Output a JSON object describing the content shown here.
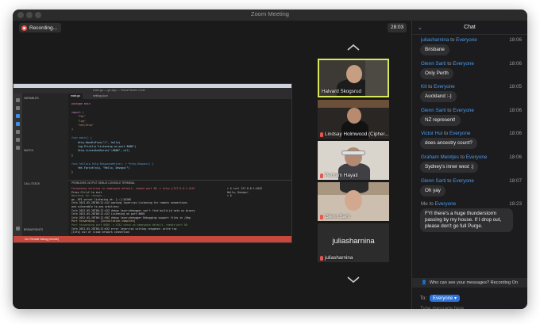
{
  "window": {
    "title": "Zoom Meeting"
  },
  "recording": {
    "label": "Recording..."
  },
  "timer": "28:03",
  "share": {
    "vscode_title": "main.go — go-app — Visual Studio Code",
    "sidebar_explorer": "VARIABLES",
    "sidebar_watch": "WATCH",
    "sidebar_callstack": "CALL STACK",
    "sidebar_breakpoints": "BREAKPOINTS",
    "tab_main": "main.go",
    "tab_settings": "settings.json",
    "panel_tabs": "PROBLEMS   OUTPUT   DEBUG CONSOLE   TERMINAL",
    "status_text": "Go: Remote Debug (remote)",
    "code": [
      "package main",
      "",
      "import (",
      "    \"fmt\"",
      "    \"log\"",
      "    \"net/http\"",
      ")",
      "",
      "func main() {",
      "    http.HandleFunc(\"/\", hello)",
      "    log.Println(\"Listening on port 8080\")",
      "    http.ListenAndServe(\":8080\", nil)",
      "}",
      "",
      "func hello(w http.ResponseWriter, r *http.Request) {",
      "    fmt.Fprintln(w, \"Hello, Devops!\")",
      "}"
    ],
    "terminal": [
      "Forwarding services in namespace default, remote port 80 -> http://127.0.0.1:4242",
      "Press Ctrl+C to exit",
      "Watching for changes...",
      "go  API server listening at: [::]:34268",
      "Info 2022-05-28T08:22:41Z warning layer=rpc Listening for remote connections",
      "and vulnerable to any arbitrary",
      "Info 2022-05-28T08:22:42Z debug layer=debugger can't find build-id note on binary",
      "Info 2022-05-28T08:22:42Z Listening on port 8080",
      "Info 2022-05-28T08:22:50Z debug layer=debugger Debugging support files in /dbg",
      "Port forwarding... [Installation complete]",
      "Port forwarding port 8080 -> 4242 check on namespace default, remote port 80",
      "Info 2022-05-28T08:23:03Z error layer=rpc writing response: write tcp",
      "[Info] out of cloud network connection"
    ],
    "terminal_right": [
      "> $ curl 127.0.0.1:4242",
      "Hello, Devops!",
      "> $"
    ]
  },
  "participants": [
    {
      "name": "Halvard Skogsrud",
      "muted": false,
      "active": true
    },
    {
      "name": "Lindsay Holmwood (Cipher...",
      "muted": true,
      "active": false
    },
    {
      "name": "Pedram Hayati",
      "muted": true,
      "active": false
    },
    {
      "name": "Glenn Sarti",
      "muted": true,
      "active": false
    },
    {
      "name": "juliasharnina",
      "muted": true,
      "active": false,
      "video_off": true
    }
  ],
  "chat": {
    "title": "Chat",
    "messages": [
      {
        "sender": "juliasharnina",
        "to": "to",
        "recipient": "Everyone",
        "time": "18:06",
        "text": "Brisbane"
      },
      {
        "sender": "Glenn Sarti",
        "to": "to",
        "recipient": "Everyone",
        "time": "18:06",
        "text": "Only Perth"
      },
      {
        "sender": "Kit",
        "to": "to",
        "recipient": "Everyone",
        "time": "18:05",
        "text": "Auckland :-)"
      },
      {
        "sender": "Glenn Sarti",
        "to": "to",
        "recipient": "Everyone",
        "time": "18:06",
        "text": "NZ represent!"
      },
      {
        "sender": "Victor Hui",
        "to": "to",
        "recipient": "Everyone",
        "time": "18:06",
        "text": "does ancestry count?"
      },
      {
        "sender": "Graham Meintjes",
        "to": "to",
        "recipient": "Everyone",
        "time": "18:06",
        "text": "Sydney's inner west :)"
      },
      {
        "sender": "Glenn Sarti",
        "to": "to",
        "recipient": "Everyone",
        "time": "18:07",
        "text": "Oh yay"
      },
      {
        "sender": "Me",
        "to": "to",
        "recipient": "Everyone",
        "time": "18:23",
        "text": "FYI there's a huge thunderstorm passing by my house. If I drop out, please don't go full Purge."
      }
    ],
    "notice": "Who can see your messages? Recording On",
    "to_label": "To:",
    "to_value": "Everyone",
    "input_placeholder": "Type message here..."
  },
  "colors": {
    "accent": "#2d72d9",
    "recording": "#e8554d",
    "active_border": "#d9e85a"
  }
}
